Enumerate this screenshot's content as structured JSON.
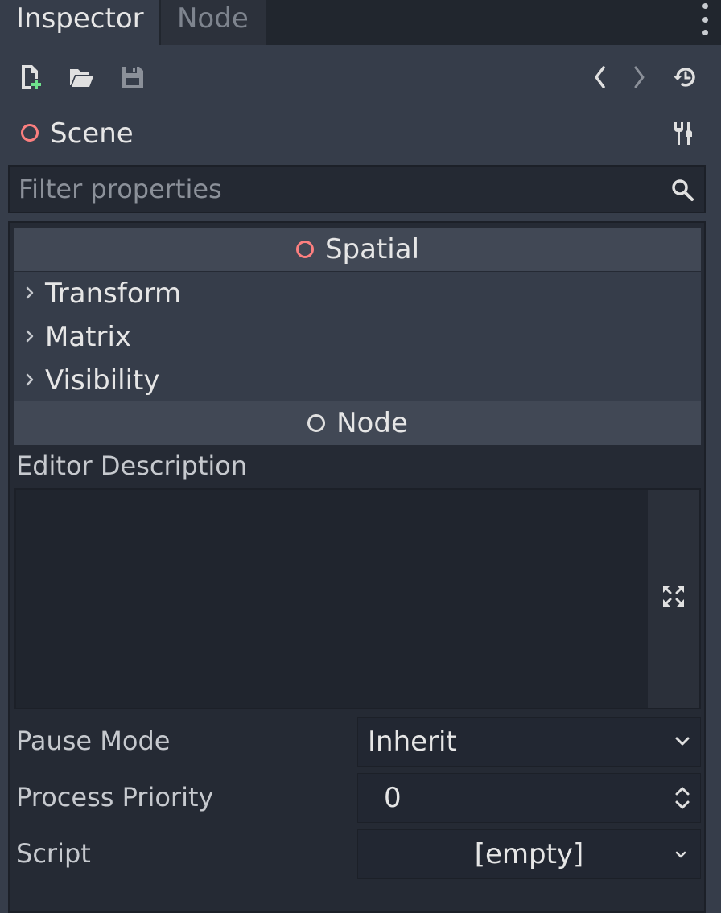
{
  "tabs": [
    {
      "label": "Inspector",
      "active": true
    },
    {
      "label": "Node",
      "active": false
    }
  ],
  "toolbar": {
    "icons": [
      "new-resource-icon",
      "open-folder-icon",
      "save-icon",
      "history-back-icon",
      "history-forward-icon",
      "object-history-icon"
    ]
  },
  "object": {
    "name": "Scene",
    "ring_color": "#fc7f7f"
  },
  "filter": {
    "placeholder": "Filter properties"
  },
  "sections": {
    "spatial": "Spatial",
    "node": "Node"
  },
  "groups": [
    "Transform",
    "Matrix",
    "Visibility"
  ],
  "properties": {
    "editor_description": {
      "label": "Editor Description",
      "value": ""
    },
    "pause_mode": {
      "label": "Pause Mode",
      "value": "Inherit"
    },
    "process_priority": {
      "label": "Process Priority",
      "value": "0"
    },
    "script": {
      "label": "Script",
      "value": "[empty]"
    }
  },
  "colors": {
    "accent_ring": "#fc7f7f",
    "panel_bg": "#363d4a",
    "field_bg": "#222732",
    "new_file_plus": "#6ee08b"
  }
}
